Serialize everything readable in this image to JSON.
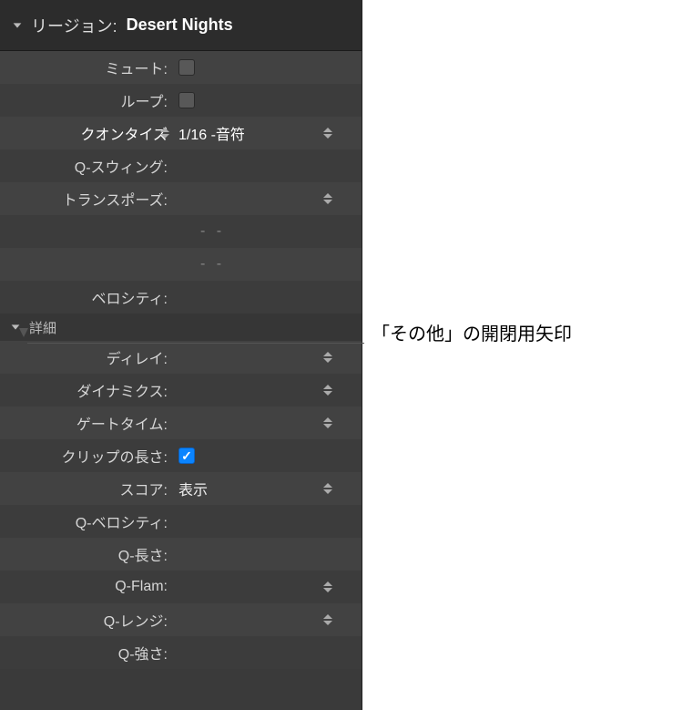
{
  "header": {
    "label": "リージョン:",
    "value": "Desert Nights"
  },
  "rows": {
    "mute": {
      "label": "ミュート:"
    },
    "loop": {
      "label": "ループ:"
    },
    "quantize": {
      "label": "クオンタイズ",
      "value": "1/16 -音符"
    },
    "qswing": {
      "label": "Q-スウィング:"
    },
    "transpose": {
      "label": "トランスポーズ:"
    },
    "dash1": {
      "value": "-  -"
    },
    "dash2": {
      "value": "-  -"
    },
    "velocity": {
      "label": "ベロシティ:"
    }
  },
  "section": {
    "label": "詳細"
  },
  "detail": {
    "delay": {
      "label": "ディレイ:"
    },
    "dynamics": {
      "label": "ダイナミクス:"
    },
    "gatetime": {
      "label": "ゲートタイム:"
    },
    "cliplength": {
      "label": "クリップの長さ:"
    },
    "score": {
      "label": "スコア:",
      "value": "表示"
    },
    "qvelocity": {
      "label": "Q-ベロシティ:"
    },
    "qlength": {
      "label": "Q-長さ:"
    },
    "qflam": {
      "label": "Q-Flam:"
    },
    "qrange": {
      "label": "Q-レンジ:"
    },
    "qstrength": {
      "label": "Q-強さ:"
    }
  },
  "callout": "「その他」の開閉用矢印"
}
